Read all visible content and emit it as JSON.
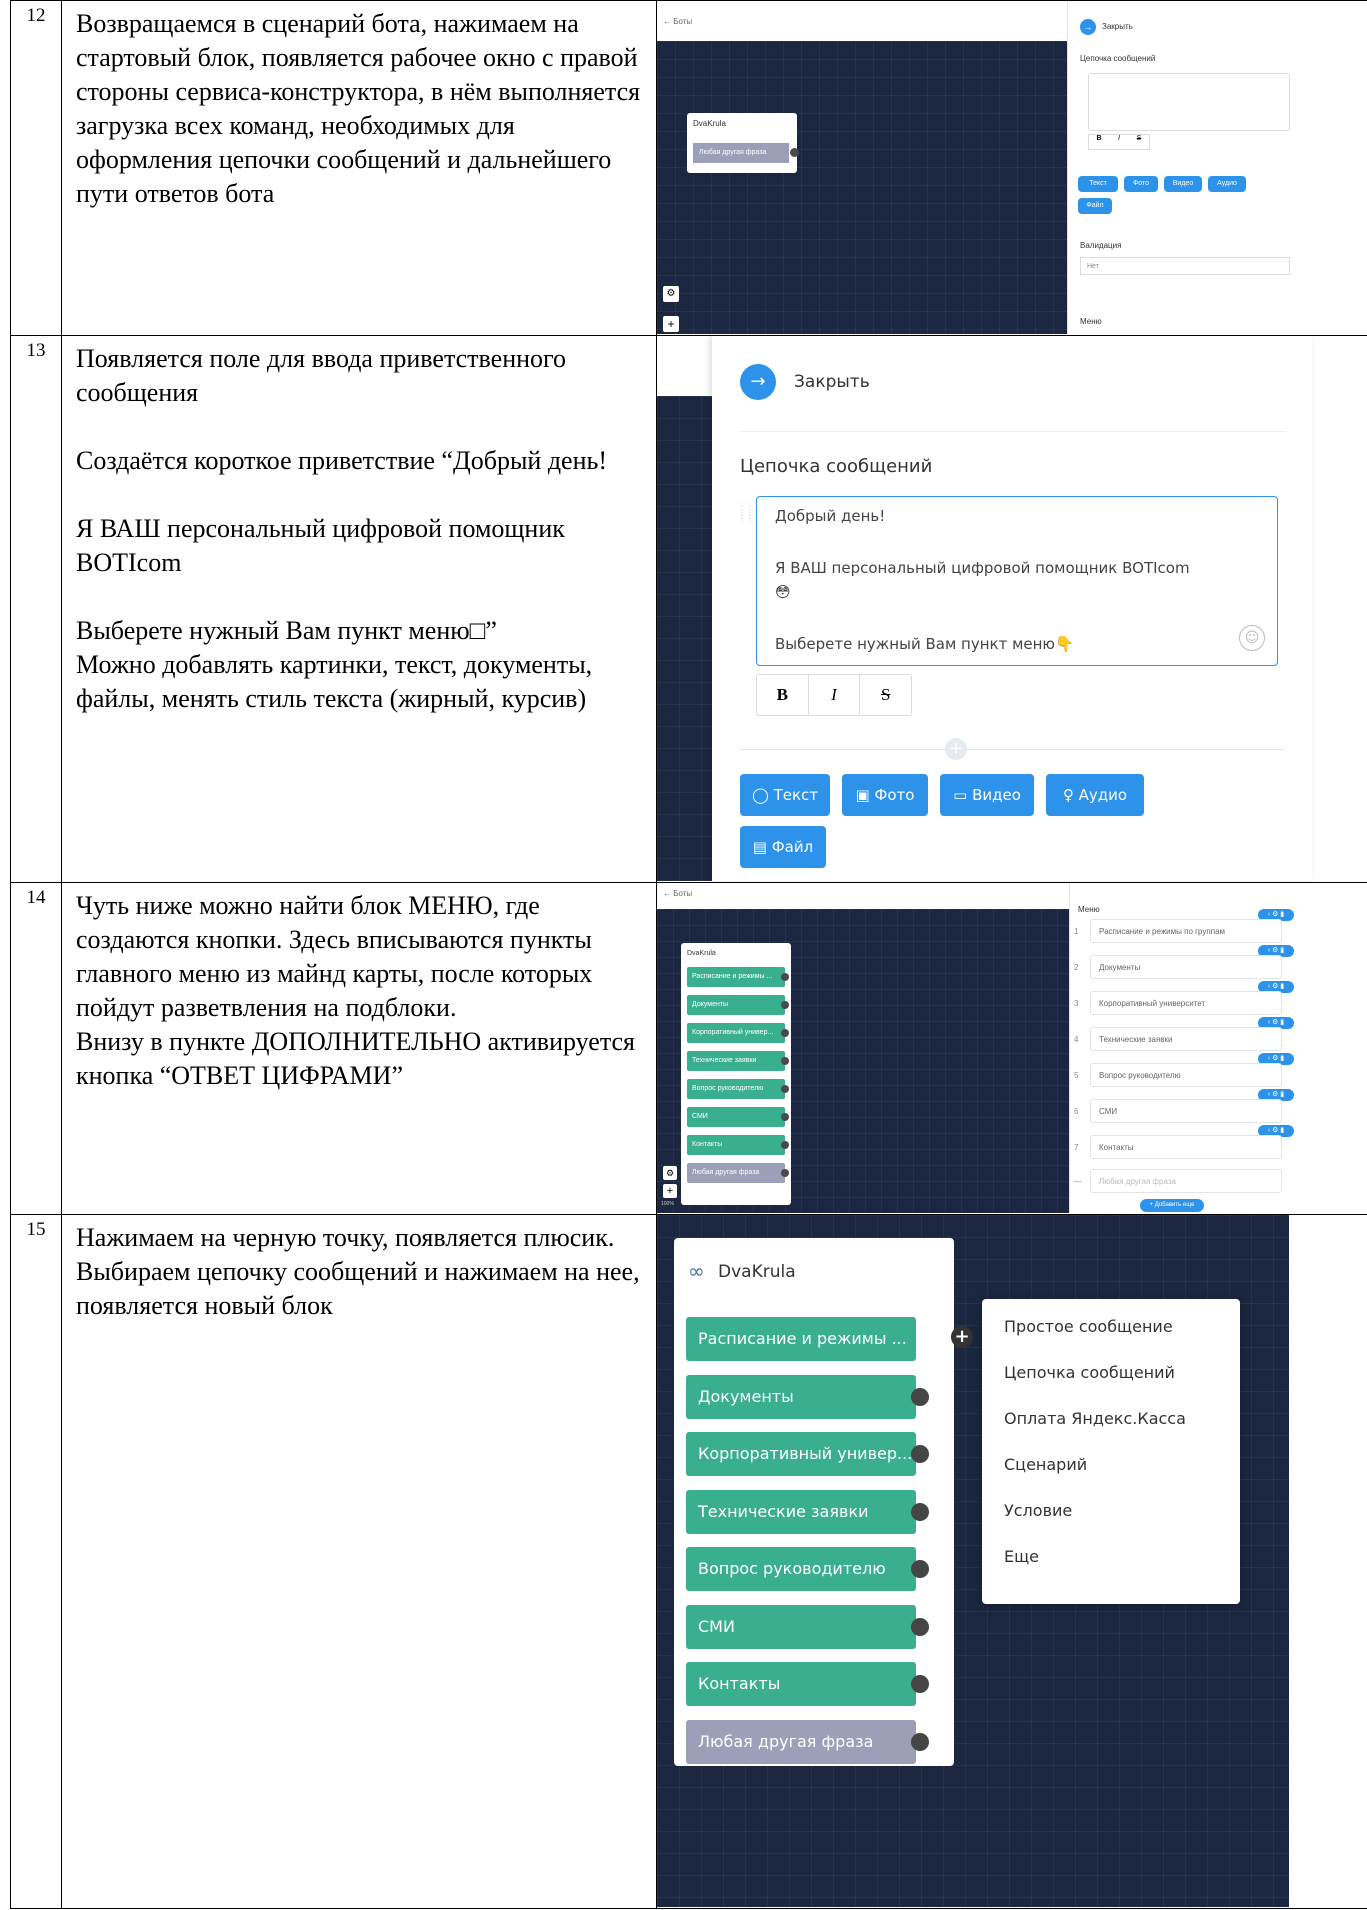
{
  "rows": [
    {
      "num": "12",
      "text": "Возвращаемся в сценарий бота, нажимаем на стартовый блок, появляется рабочее окно с правой стороны сервиса-конструктора, в нём выполняется загрузка всех команд, необходимых для оформления цепочки сообщений и дальнейшего пути ответов бота",
      "shot": {
        "back_label": "← Боты",
        "block_title": "DvaKrula",
        "block_item": "Любая другая фраза",
        "panel_close": "Закрыть",
        "panel_chain_label": "Цепочка сообщений",
        "format_bold": "B",
        "format_italic": "I",
        "format_strike": "S",
        "buttons": [
          "Текст",
          "Фото",
          "Видео",
          "Аудио",
          "Файл"
        ],
        "validation_label": "Валидация",
        "validation_value": "Нет",
        "menu_label": "Меню"
      }
    },
    {
      "num": "13",
      "text": "Появляется поле для ввода приветственного сообщения\n\nСоздаётся короткое приветствие “Добрый день!\n\nЯ ВАШ персональный цифровой помощник BOTIcom\n\nВыберете нужный Вам пункт меню□”\nМожно добавлять картинки, текст, документы, файлы, менять стиль текста (жирный, курсив)",
      "shot": {
        "close_label": "Закрыть",
        "chain_label": "Цепочка сообщений",
        "msg_line1": "Добрый день!",
        "msg_line2": "Я ВАШ персональный цифровой помощник BOTIcom",
        "msg_emoji": "😳",
        "msg_line3": "Выберете нужный Вам пункт меню",
        "msg_emoji2": "👇",
        "format_bold": "B",
        "format_italic": "I",
        "format_strike": "S",
        "plus": "+",
        "buttons": [
          "Текст",
          "Фото",
          "Видео",
          "Аудио",
          "Файл"
        ]
      }
    },
    {
      "num": "14",
      "text": "Чуть ниже можно найти блок МЕНЮ, где создаются кнопки. Здесь вписываются пункты главного меню из майнд карты, после которых пойдут разветвления на подблоки.\nВнизу в пункте ДОПОЛНИТЕЛЬНО активируется кнопка “ОТВЕТ ЦИФРАМИ”",
      "shot": {
        "back_label": "← Боты",
        "block_title": "DvaKrula",
        "block_items": [
          "Расписание и режимы ...",
          "Документы",
          "Корпоративный универ...",
          "Технические заявки",
          "Вопрос руководителю",
          "СМИ",
          "Контакты"
        ],
        "block_last": "Любая другая фраза",
        "menu_label": "Меню",
        "menu_items": [
          {
            "idx": "1",
            "label": "Расписание и режимы по группам"
          },
          {
            "idx": "2",
            "label": "Документы"
          },
          {
            "idx": "3",
            "label": "Корпоративный университет"
          },
          {
            "idx": "4",
            "label": "Технические заявки"
          },
          {
            "idx": "5",
            "label": "Вопрос руководителю"
          },
          {
            "idx": "6",
            "label": "СМИ"
          },
          {
            "idx": "7",
            "label": "Контакты"
          }
        ],
        "menu_last": "Любая другая фраза",
        "menu_last_idx": "—",
        "add_more": "+ Добавить еще",
        "zoom": "100%"
      }
    },
    {
      "num": "15",
      "text": "Нажимаем на черную точку, появляется плюсик. Выбираем цепочку сообщений и нажимаем на нее, появляется новый блок",
      "shot": {
        "block_title": "DvaKrula",
        "block_items": [
          "Расписание и режимы ...",
          "Документы",
          "Корпоративный универ...",
          "Технические заявки",
          "Вопрос руководителю",
          "СМИ",
          "Контакты"
        ],
        "block_last": "Любая другая фраза",
        "dropdown": [
          "Простое сообщение",
          "Цепочка сообщений",
          "Оплата Яндекс.Касса",
          "Сценарий",
          "Условие",
          "Еще"
        ]
      }
    }
  ],
  "colors": {
    "canvas": "#1b2740",
    "green_item": "#3aaf8f",
    "gray_item": "#9ba0b8",
    "accent_blue": "#2d92ea"
  }
}
